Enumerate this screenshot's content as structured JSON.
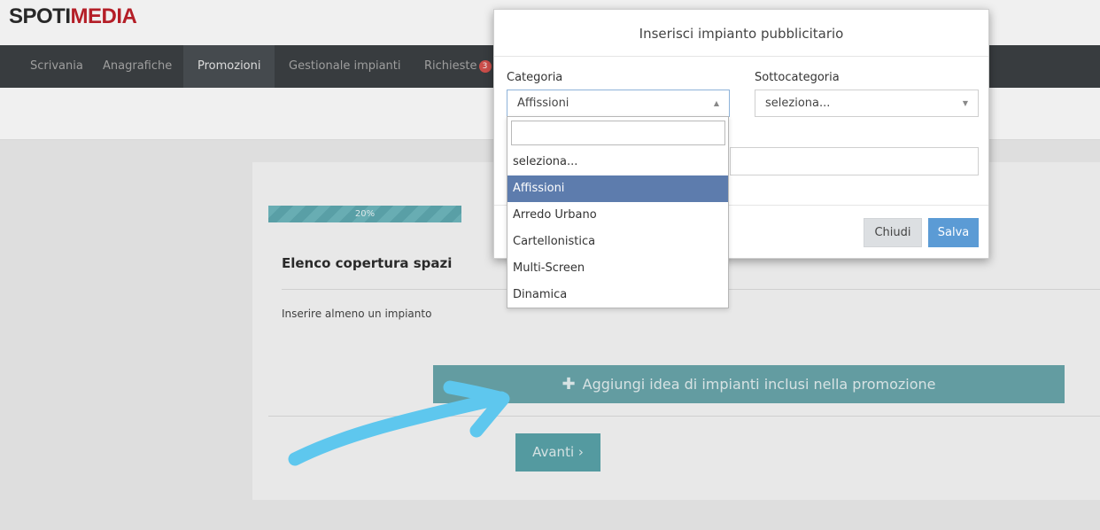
{
  "logo": {
    "part1": "SPOTI",
    "part2": "MEDIA"
  },
  "nav": {
    "items": [
      {
        "label": "Scrivania"
      },
      {
        "label": "Anagrafiche"
      },
      {
        "label": "Promozioni"
      },
      {
        "label": "Gestionale impianti"
      },
      {
        "label": "Richieste"
      }
    ],
    "badge_count": "3"
  },
  "panel": {
    "progress": {
      "label": "20%",
      "value": 20
    },
    "title": "Elenco copertura spazi",
    "hint": "Inserire almeno un impianto",
    "add_button": {
      "icon": "plus-icon",
      "label": "Aggiungi idea di impianti inclusi nella promozione"
    },
    "next_button": "Avanti ›"
  },
  "modal": {
    "title": "Inserisci impianto pubblicitario",
    "category": {
      "label": "Categoria",
      "value": "Affissioni"
    },
    "subcategory": {
      "label": "Sottocategoria",
      "value": "seleziona..."
    },
    "close_button": "Chiudi",
    "save_button": "Salva"
  },
  "dropdown": {
    "search_value": "",
    "options": [
      {
        "label": "seleziona..."
      },
      {
        "label": "Affissioni",
        "selected": true
      },
      {
        "label": "Arredo Urbano"
      },
      {
        "label": "Cartellonistica"
      },
      {
        "label": "Multi-Screen"
      },
      {
        "label": "Dinamica"
      }
    ]
  },
  "colors": {
    "accent_teal": "#6aa6ac",
    "save_blue": "#5b9bd5",
    "selected_option": "#5d7cad",
    "annotation_arrow": "#5ec7ee"
  }
}
